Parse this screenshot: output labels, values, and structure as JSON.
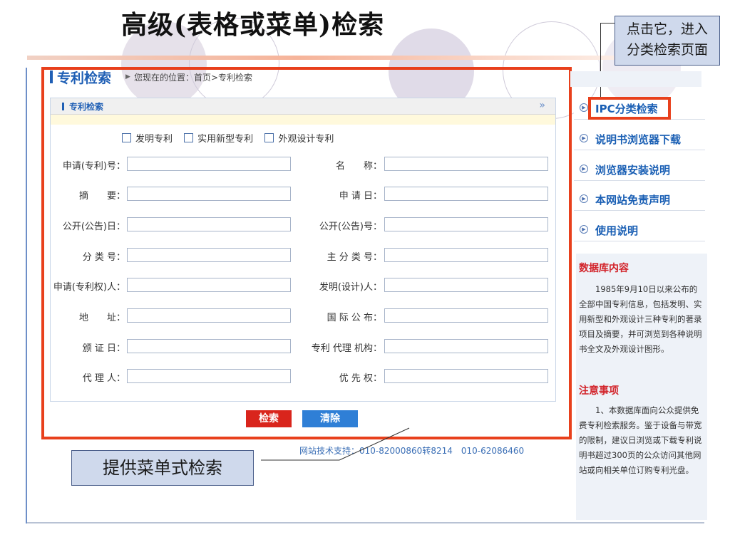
{
  "slide": {
    "title": "高级(表格或菜单)检索",
    "callout_top": [
      "点击它，进入",
      "分类检索页面"
    ],
    "callout_bottom": "提供菜单式检索"
  },
  "page": {
    "header_title": "专利检索",
    "breadcrumb": "您现在的位置：首页>专利检索"
  },
  "panel": {
    "title": "专利检索",
    "more_icon": "»",
    "patent_types": [
      "发明专利",
      "实用新型专利",
      "外观设计专利"
    ]
  },
  "form": {
    "left_labels": [
      "申请(专利)号：",
      "摘　　要：",
      "公开(公告)日：",
      "分 类 号：",
      "申请(专利权)人：",
      "地　　址：",
      "颁 证 日：",
      "代 理 人："
    ],
    "right_labels": [
      "名　　称：",
      "申 请 日：",
      "公开(公告)号：",
      "主 分 类 号：",
      "发明(设计)人：",
      "国 际 公 布：",
      "专利 代理 机构：",
      "优 先 权："
    ],
    "left_values": [
      "",
      "",
      "",
      "",
      "",
      "",
      "",
      ""
    ],
    "right_values": [
      "",
      "",
      "",
      "",
      "",
      "",
      "",
      ""
    ]
  },
  "buttons": {
    "search": "检索",
    "clear": "清除"
  },
  "support_text": "网站技术支持：010-82000860转8214　010-62086460",
  "sidebar": {
    "items": [
      "IPC分类检索",
      "说明书浏览器下载",
      "浏览器安装说明",
      "本网站免责声明",
      "使用说明"
    ]
  },
  "info": {
    "db_title": "数据库内容",
    "db_text": "1985年9月10日以来公布的全部中国专利信息，包括发明、实用新型和外观设计三种专利的著录项目及摘要，并可浏览到各种说明书全文及外观设计图形。",
    "notice_title": "注意事项",
    "notice_text": "1、本数据库面向公众提供免费专利检索服务。鉴于设备与带宽的限制，建议日浏览或下载专利说明书超过300页的公众访问其他网站或向相关单位订购专利光盘。"
  },
  "colors": {
    "highlight_frame": "#e8401c",
    "link_blue": "#1a5fb4",
    "search_button": "#d9251c",
    "clear_button": "#2f7fd6",
    "sidebar_heading": "#d2232a"
  }
}
